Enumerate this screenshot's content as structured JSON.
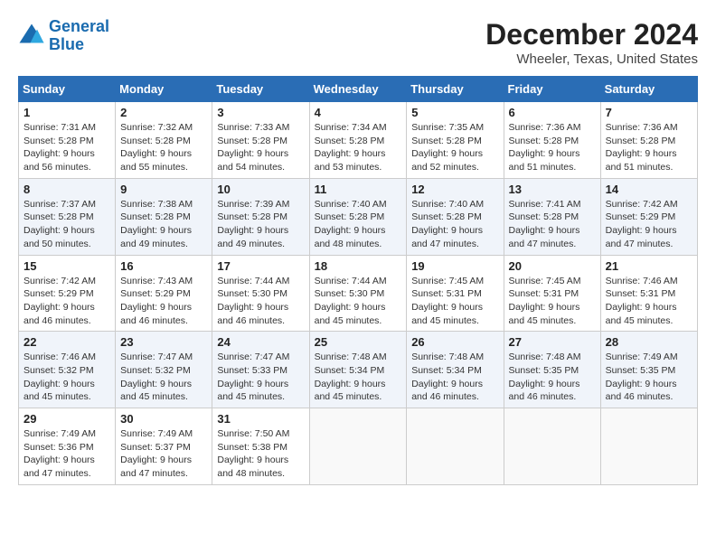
{
  "header": {
    "logo_line1": "General",
    "logo_line2": "Blue",
    "title": "December 2024",
    "subtitle": "Wheeler, Texas, United States"
  },
  "columns": [
    "Sunday",
    "Monday",
    "Tuesday",
    "Wednesday",
    "Thursday",
    "Friday",
    "Saturday"
  ],
  "weeks": [
    [
      {
        "day": "1",
        "sunrise": "Sunrise: 7:31 AM",
        "sunset": "Sunset: 5:28 PM",
        "daylight": "Daylight: 9 hours and 56 minutes."
      },
      {
        "day": "2",
        "sunrise": "Sunrise: 7:32 AM",
        "sunset": "Sunset: 5:28 PM",
        "daylight": "Daylight: 9 hours and 55 minutes."
      },
      {
        "day": "3",
        "sunrise": "Sunrise: 7:33 AM",
        "sunset": "Sunset: 5:28 PM",
        "daylight": "Daylight: 9 hours and 54 minutes."
      },
      {
        "day": "4",
        "sunrise": "Sunrise: 7:34 AM",
        "sunset": "Sunset: 5:28 PM",
        "daylight": "Daylight: 9 hours and 53 minutes."
      },
      {
        "day": "5",
        "sunrise": "Sunrise: 7:35 AM",
        "sunset": "Sunset: 5:28 PM",
        "daylight": "Daylight: 9 hours and 52 minutes."
      },
      {
        "day": "6",
        "sunrise": "Sunrise: 7:36 AM",
        "sunset": "Sunset: 5:28 PM",
        "daylight": "Daylight: 9 hours and 51 minutes."
      },
      {
        "day": "7",
        "sunrise": "Sunrise: 7:36 AM",
        "sunset": "Sunset: 5:28 PM",
        "daylight": "Daylight: 9 hours and 51 minutes."
      }
    ],
    [
      {
        "day": "8",
        "sunrise": "Sunrise: 7:37 AM",
        "sunset": "Sunset: 5:28 PM",
        "daylight": "Daylight: 9 hours and 50 minutes."
      },
      {
        "day": "9",
        "sunrise": "Sunrise: 7:38 AM",
        "sunset": "Sunset: 5:28 PM",
        "daylight": "Daylight: 9 hours and 49 minutes."
      },
      {
        "day": "10",
        "sunrise": "Sunrise: 7:39 AM",
        "sunset": "Sunset: 5:28 PM",
        "daylight": "Daylight: 9 hours and 49 minutes."
      },
      {
        "day": "11",
        "sunrise": "Sunrise: 7:40 AM",
        "sunset": "Sunset: 5:28 PM",
        "daylight": "Daylight: 9 hours and 48 minutes."
      },
      {
        "day": "12",
        "sunrise": "Sunrise: 7:40 AM",
        "sunset": "Sunset: 5:28 PM",
        "daylight": "Daylight: 9 hours and 47 minutes."
      },
      {
        "day": "13",
        "sunrise": "Sunrise: 7:41 AM",
        "sunset": "Sunset: 5:28 PM",
        "daylight": "Daylight: 9 hours and 47 minutes."
      },
      {
        "day": "14",
        "sunrise": "Sunrise: 7:42 AM",
        "sunset": "Sunset: 5:29 PM",
        "daylight": "Daylight: 9 hours and 47 minutes."
      }
    ],
    [
      {
        "day": "15",
        "sunrise": "Sunrise: 7:42 AM",
        "sunset": "Sunset: 5:29 PM",
        "daylight": "Daylight: 9 hours and 46 minutes."
      },
      {
        "day": "16",
        "sunrise": "Sunrise: 7:43 AM",
        "sunset": "Sunset: 5:29 PM",
        "daylight": "Daylight: 9 hours and 46 minutes."
      },
      {
        "day": "17",
        "sunrise": "Sunrise: 7:44 AM",
        "sunset": "Sunset: 5:30 PM",
        "daylight": "Daylight: 9 hours and 46 minutes."
      },
      {
        "day": "18",
        "sunrise": "Sunrise: 7:44 AM",
        "sunset": "Sunset: 5:30 PM",
        "daylight": "Daylight: 9 hours and 45 minutes."
      },
      {
        "day": "19",
        "sunrise": "Sunrise: 7:45 AM",
        "sunset": "Sunset: 5:31 PM",
        "daylight": "Daylight: 9 hours and 45 minutes."
      },
      {
        "day": "20",
        "sunrise": "Sunrise: 7:45 AM",
        "sunset": "Sunset: 5:31 PM",
        "daylight": "Daylight: 9 hours and 45 minutes."
      },
      {
        "day": "21",
        "sunrise": "Sunrise: 7:46 AM",
        "sunset": "Sunset: 5:31 PM",
        "daylight": "Daylight: 9 hours and 45 minutes."
      }
    ],
    [
      {
        "day": "22",
        "sunrise": "Sunrise: 7:46 AM",
        "sunset": "Sunset: 5:32 PM",
        "daylight": "Daylight: 9 hours and 45 minutes."
      },
      {
        "day": "23",
        "sunrise": "Sunrise: 7:47 AM",
        "sunset": "Sunset: 5:32 PM",
        "daylight": "Daylight: 9 hours and 45 minutes."
      },
      {
        "day": "24",
        "sunrise": "Sunrise: 7:47 AM",
        "sunset": "Sunset: 5:33 PM",
        "daylight": "Daylight: 9 hours and 45 minutes."
      },
      {
        "day": "25",
        "sunrise": "Sunrise: 7:48 AM",
        "sunset": "Sunset: 5:34 PM",
        "daylight": "Daylight: 9 hours and 45 minutes."
      },
      {
        "day": "26",
        "sunrise": "Sunrise: 7:48 AM",
        "sunset": "Sunset: 5:34 PM",
        "daylight": "Daylight: 9 hours and 46 minutes."
      },
      {
        "day": "27",
        "sunrise": "Sunrise: 7:48 AM",
        "sunset": "Sunset: 5:35 PM",
        "daylight": "Daylight: 9 hours and 46 minutes."
      },
      {
        "day": "28",
        "sunrise": "Sunrise: 7:49 AM",
        "sunset": "Sunset: 5:35 PM",
        "daylight": "Daylight: 9 hours and 46 minutes."
      }
    ],
    [
      {
        "day": "29",
        "sunrise": "Sunrise: 7:49 AM",
        "sunset": "Sunset: 5:36 PM",
        "daylight": "Daylight: 9 hours and 47 minutes."
      },
      {
        "day": "30",
        "sunrise": "Sunrise: 7:49 AM",
        "sunset": "Sunset: 5:37 PM",
        "daylight": "Daylight: 9 hours and 47 minutes."
      },
      {
        "day": "31",
        "sunrise": "Sunrise: 7:50 AM",
        "sunset": "Sunset: 5:38 PM",
        "daylight": "Daylight: 9 hours and 48 minutes."
      },
      null,
      null,
      null,
      null
    ]
  ]
}
